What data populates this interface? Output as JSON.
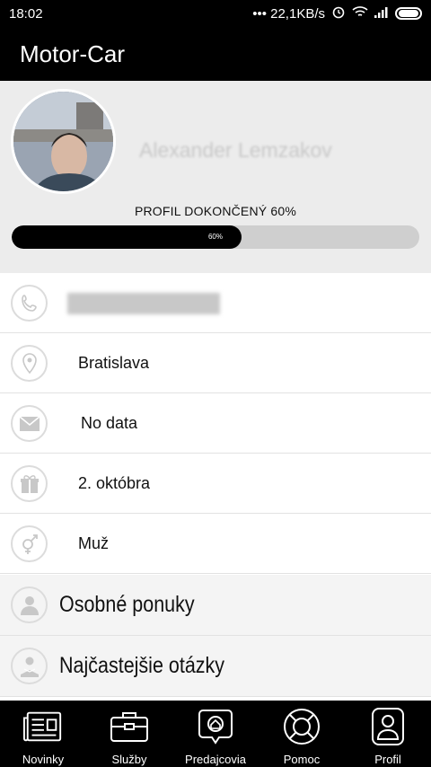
{
  "status": {
    "time": "18:02",
    "network": "••• 22,1KB/s"
  },
  "app": {
    "title": "Motor-Car"
  },
  "profile": {
    "name": "Alexander Lemzakov",
    "completion_label": "PROFIL DOKONČENÝ 60%",
    "completion_value": 0.6,
    "completion_text": "60%"
  },
  "info": {
    "city": "Bratislava",
    "email": "No data",
    "birthday": "2. októbra",
    "gender": "Muž"
  },
  "menu": {
    "offers": "Osobné ponuky",
    "faq": "Najčastejšie otázky"
  },
  "nav": [
    {
      "label": "Novinky",
      "icon": "news-icon"
    },
    {
      "label": "Služby",
      "icon": "briefcase-icon"
    },
    {
      "label": "Predajcovia",
      "icon": "dealer-icon"
    },
    {
      "label": "Pomoc",
      "icon": "lifebuoy-icon"
    },
    {
      "label": "Profil",
      "icon": "user-icon"
    }
  ],
  "colors": {
    "bar": "#000000",
    "accent_fill": "#000000",
    "track": "#cfcfcf"
  }
}
